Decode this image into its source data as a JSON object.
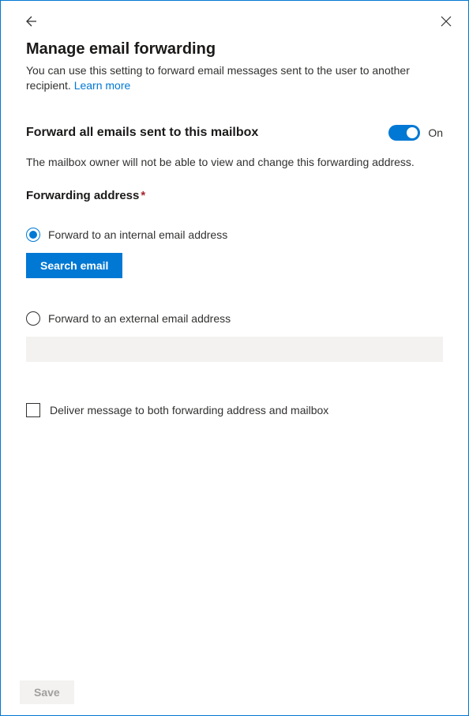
{
  "header": {
    "title": "Manage email forwarding",
    "description": "You can use this setting to forward email messages sent to the user to another recipient. ",
    "learn_more": "Learn more"
  },
  "forward_toggle": {
    "label": "Forward all emails sent to this mailbox",
    "state_text": "On",
    "helper": "The mailbox owner will not be able to view and change this forwarding address."
  },
  "forwarding_address": {
    "label": "Forwarding address",
    "required_mark": "*",
    "internal_option": "Forward to an internal email address",
    "search_button": "Search email",
    "external_option": "Forward to an external email address",
    "external_value": ""
  },
  "deliver_both": {
    "label": "Deliver message to both forwarding address and mailbox"
  },
  "footer": {
    "save": "Save"
  }
}
